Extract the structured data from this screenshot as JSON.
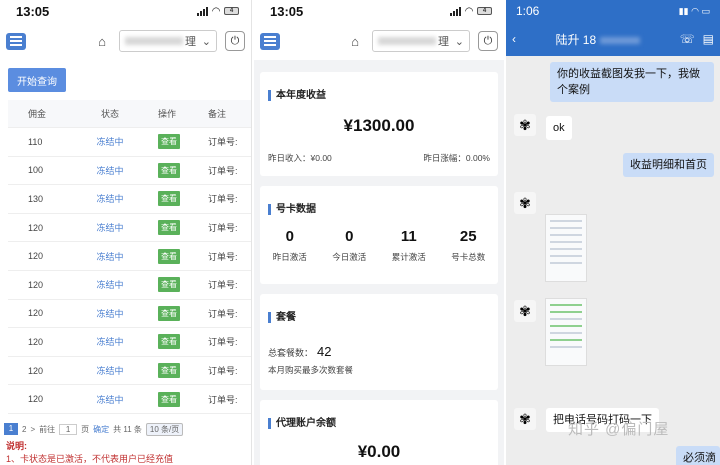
{
  "panel1": {
    "time": "13:05",
    "battery": "4",
    "select_suffix": "理",
    "query_button": "开始查询",
    "columns": [
      "佣金",
      "状态",
      "操作",
      "备注"
    ],
    "rows": [
      {
        "amount": "110",
        "status": "冻结中",
        "action": "查看",
        "remark": "订单号:"
      },
      {
        "amount": "100",
        "status": "冻结中",
        "action": "查看",
        "remark": "订单号:"
      },
      {
        "amount": "130",
        "status": "冻结中",
        "action": "查看",
        "remark": "订单号:"
      },
      {
        "amount": "120",
        "status": "冻结中",
        "action": "查看",
        "remark": "订单号:"
      },
      {
        "amount": "120",
        "status": "冻结中",
        "action": "查看",
        "remark": "订单号:"
      },
      {
        "amount": "120",
        "status": "冻结中",
        "action": "查看",
        "remark": "订单号:"
      },
      {
        "amount": "120",
        "status": "冻结中",
        "action": "查看",
        "remark": "订单号:"
      },
      {
        "amount": "120",
        "status": "冻结中",
        "action": "查看",
        "remark": "订单号:"
      },
      {
        "amount": "120",
        "status": "冻结中",
        "action": "查看",
        "remark": "订单号:"
      },
      {
        "amount": "120",
        "status": "冻结中",
        "action": "查看",
        "remark": "订单号:"
      }
    ],
    "pager": {
      "page1": "1",
      "page2": "2",
      "next": ">",
      "goto": "前往",
      "input": "1",
      "unit": "页",
      "confirm": "确定",
      "total": "共 11 条",
      "per_page": "10 条/页"
    },
    "note_title": "说明:",
    "note_line": "1、卡状态是已激活，不代表用户已经充值"
  },
  "panel2": {
    "time": "13:05",
    "battery": "4",
    "select_suffix": "理",
    "annual": {
      "title": "本年度收益",
      "amount": "¥1300.00",
      "yesterday": "昨日收入：¥0.00",
      "growth": "昨日涨幅：0.00%"
    },
    "cards_data": {
      "title": "号卡数据",
      "stats": [
        {
          "value": "0",
          "label": "昨日激活"
        },
        {
          "value": "0",
          "label": "今日激活"
        },
        {
          "value": "11",
          "label": "累计激活"
        },
        {
          "value": "25",
          "label": "号卡总数"
        }
      ]
    },
    "package": {
      "title": "套餐",
      "count_label": "总套餐数：",
      "count": "42",
      "desc": "本月购买最多次数套餐"
    },
    "balance": {
      "title": "代理账户余额",
      "amount": "¥0.00"
    }
  },
  "panel3": {
    "time": "1:06",
    "contact": "陆升 18",
    "messages": [
      {
        "dir": "out",
        "text": "你的收益截图发我一下，我做个案例"
      },
      {
        "dir": "in",
        "text": "ok"
      },
      {
        "dir": "out",
        "text": "收益明细和首页"
      },
      {
        "dir": "in",
        "text": "把电话号码打码一下"
      },
      {
        "dir": "out",
        "text": "必须滴"
      }
    ],
    "watermark": "知乎 @偏门屋"
  },
  "colors": {
    "accent": "#4a7fd0",
    "view_button": "#5ab15a",
    "status_text": "#4a7fd0",
    "note_red": "#c03030",
    "chat_header": "#2e6fc7",
    "bubble_out": "#c9dcf7"
  },
  "icons": [
    "menu-icon",
    "home-icon",
    "power-icon",
    "back-icon",
    "contact-card-icon",
    "more-icon",
    "avatar-icon"
  ]
}
